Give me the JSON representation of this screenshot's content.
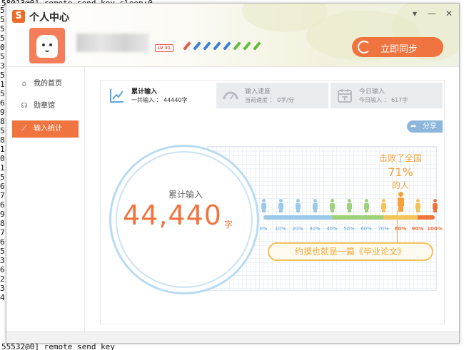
{
  "terminal": {
    "top_line": "58013@0] remote send key sleep:0",
    "bottom_line": "55532@0] remote send key",
    "left_margin_digits": [
      "5",
      "5",
      "5",
      "5",
      "0",
      "5",
      "3",
      "5",
      "1",
      "5",
      "6",
      "9",
      "8",
      "5",
      "8",
      "1",
      "0",
      "1",
      "5",
      "6",
      "7",
      "6",
      "9",
      "8",
      "7",
      "6",
      "5",
      "3",
      "6",
      "2",
      "3",
      "4"
    ]
  },
  "window": {
    "title": "个人中心",
    "app_logo_glyph": "S",
    "controls": {
      "menu": "▾",
      "minimize": "—",
      "close": "✕"
    }
  },
  "profile": {
    "level_badge": "LV 31",
    "pens": [
      {
        "color": "#e25c4f",
        "icon": "pen-icon"
      },
      {
        "color": "#3d7fd6",
        "icon": "pen-icon"
      },
      {
        "color": "#3d7fd6",
        "icon": "pen-icon"
      },
      {
        "color": "#3d7fd6",
        "icon": "pen-icon"
      },
      {
        "color": "#3d7fd6",
        "icon": "pen-icon"
      },
      {
        "color": "#5fbd3e",
        "icon": "pen-icon"
      },
      {
        "color": "#5fbd3e",
        "icon": "pen-icon"
      },
      {
        "color": "#5fbd3e",
        "icon": "pen-icon"
      }
    ],
    "sync_button": "立即同步"
  },
  "sidebar": {
    "items": [
      {
        "label": "我的首页",
        "icon": "home-icon",
        "icon_glyph": "⌂",
        "active": false
      },
      {
        "label": "勋章馆",
        "icon": "medal-icon",
        "icon_glyph": "☊",
        "active": false
      },
      {
        "label": "输入统计",
        "icon": "stats-icon",
        "icon_glyph": "⟋",
        "active": true
      }
    ]
  },
  "stats_tabs": [
    {
      "title": "累计输入",
      "detail": "一共输入 ： 44440字",
      "icon": "chart-icon",
      "active": true
    },
    {
      "title": "输入速度",
      "detail": "当前速度 ： 0字/分",
      "icon": "speedometer-icon",
      "active": false
    },
    {
      "title": "今日输入",
      "detail": "今日输入 ： 617字",
      "icon": "calendar-icon",
      "active": false
    }
  ],
  "share_button": "分享",
  "cumulative": {
    "label": "累计输入",
    "value": "44,440",
    "unit": "字"
  },
  "ranking": {
    "beat_line1": "击败了全国",
    "beat_percent": "71%",
    "beat_line2": "的人",
    "percentile_position": 0.71,
    "ticks": [
      "0%",
      "10%",
      "20%",
      "30%",
      "40%",
      "50%",
      "60%",
      "70%",
      "80%",
      "90%",
      "100%"
    ],
    "slogan": "约摸也就是一篇《毕业论文》"
  },
  "colors": {
    "accent": "#f0743f",
    "highlight": "#f3a33a",
    "circle_ring": "#b9dbf3",
    "tick_blue": "#5aa7de"
  }
}
